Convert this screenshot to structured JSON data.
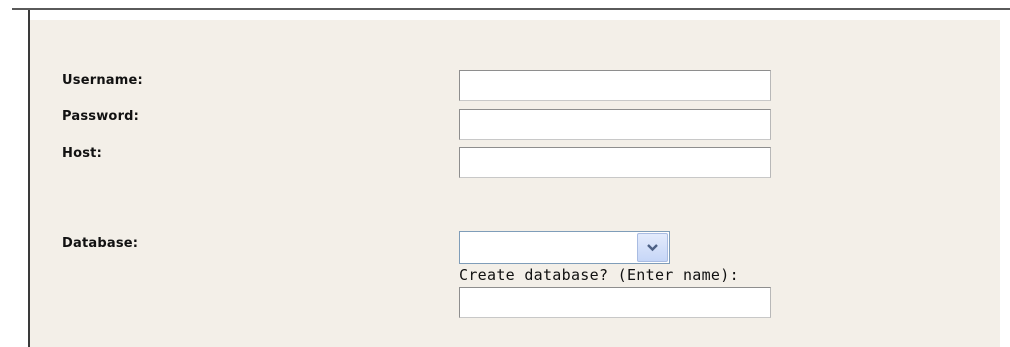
{
  "form": {
    "username_label": "Username:",
    "username_value": "",
    "password_label": "Password:",
    "password_value": "",
    "host_label": "Host:",
    "host_value": "",
    "database_label": "Database:",
    "database_selected": "",
    "database_dropdown_icon": "chevron-down-icon",
    "create_database_hint": "Create database? (Enter name):",
    "new_database_value": ""
  },
  "colors": {
    "panel_background": "#f3efe8",
    "border": "#8e8e8e",
    "dropdown_button": "#c6d6f7"
  }
}
